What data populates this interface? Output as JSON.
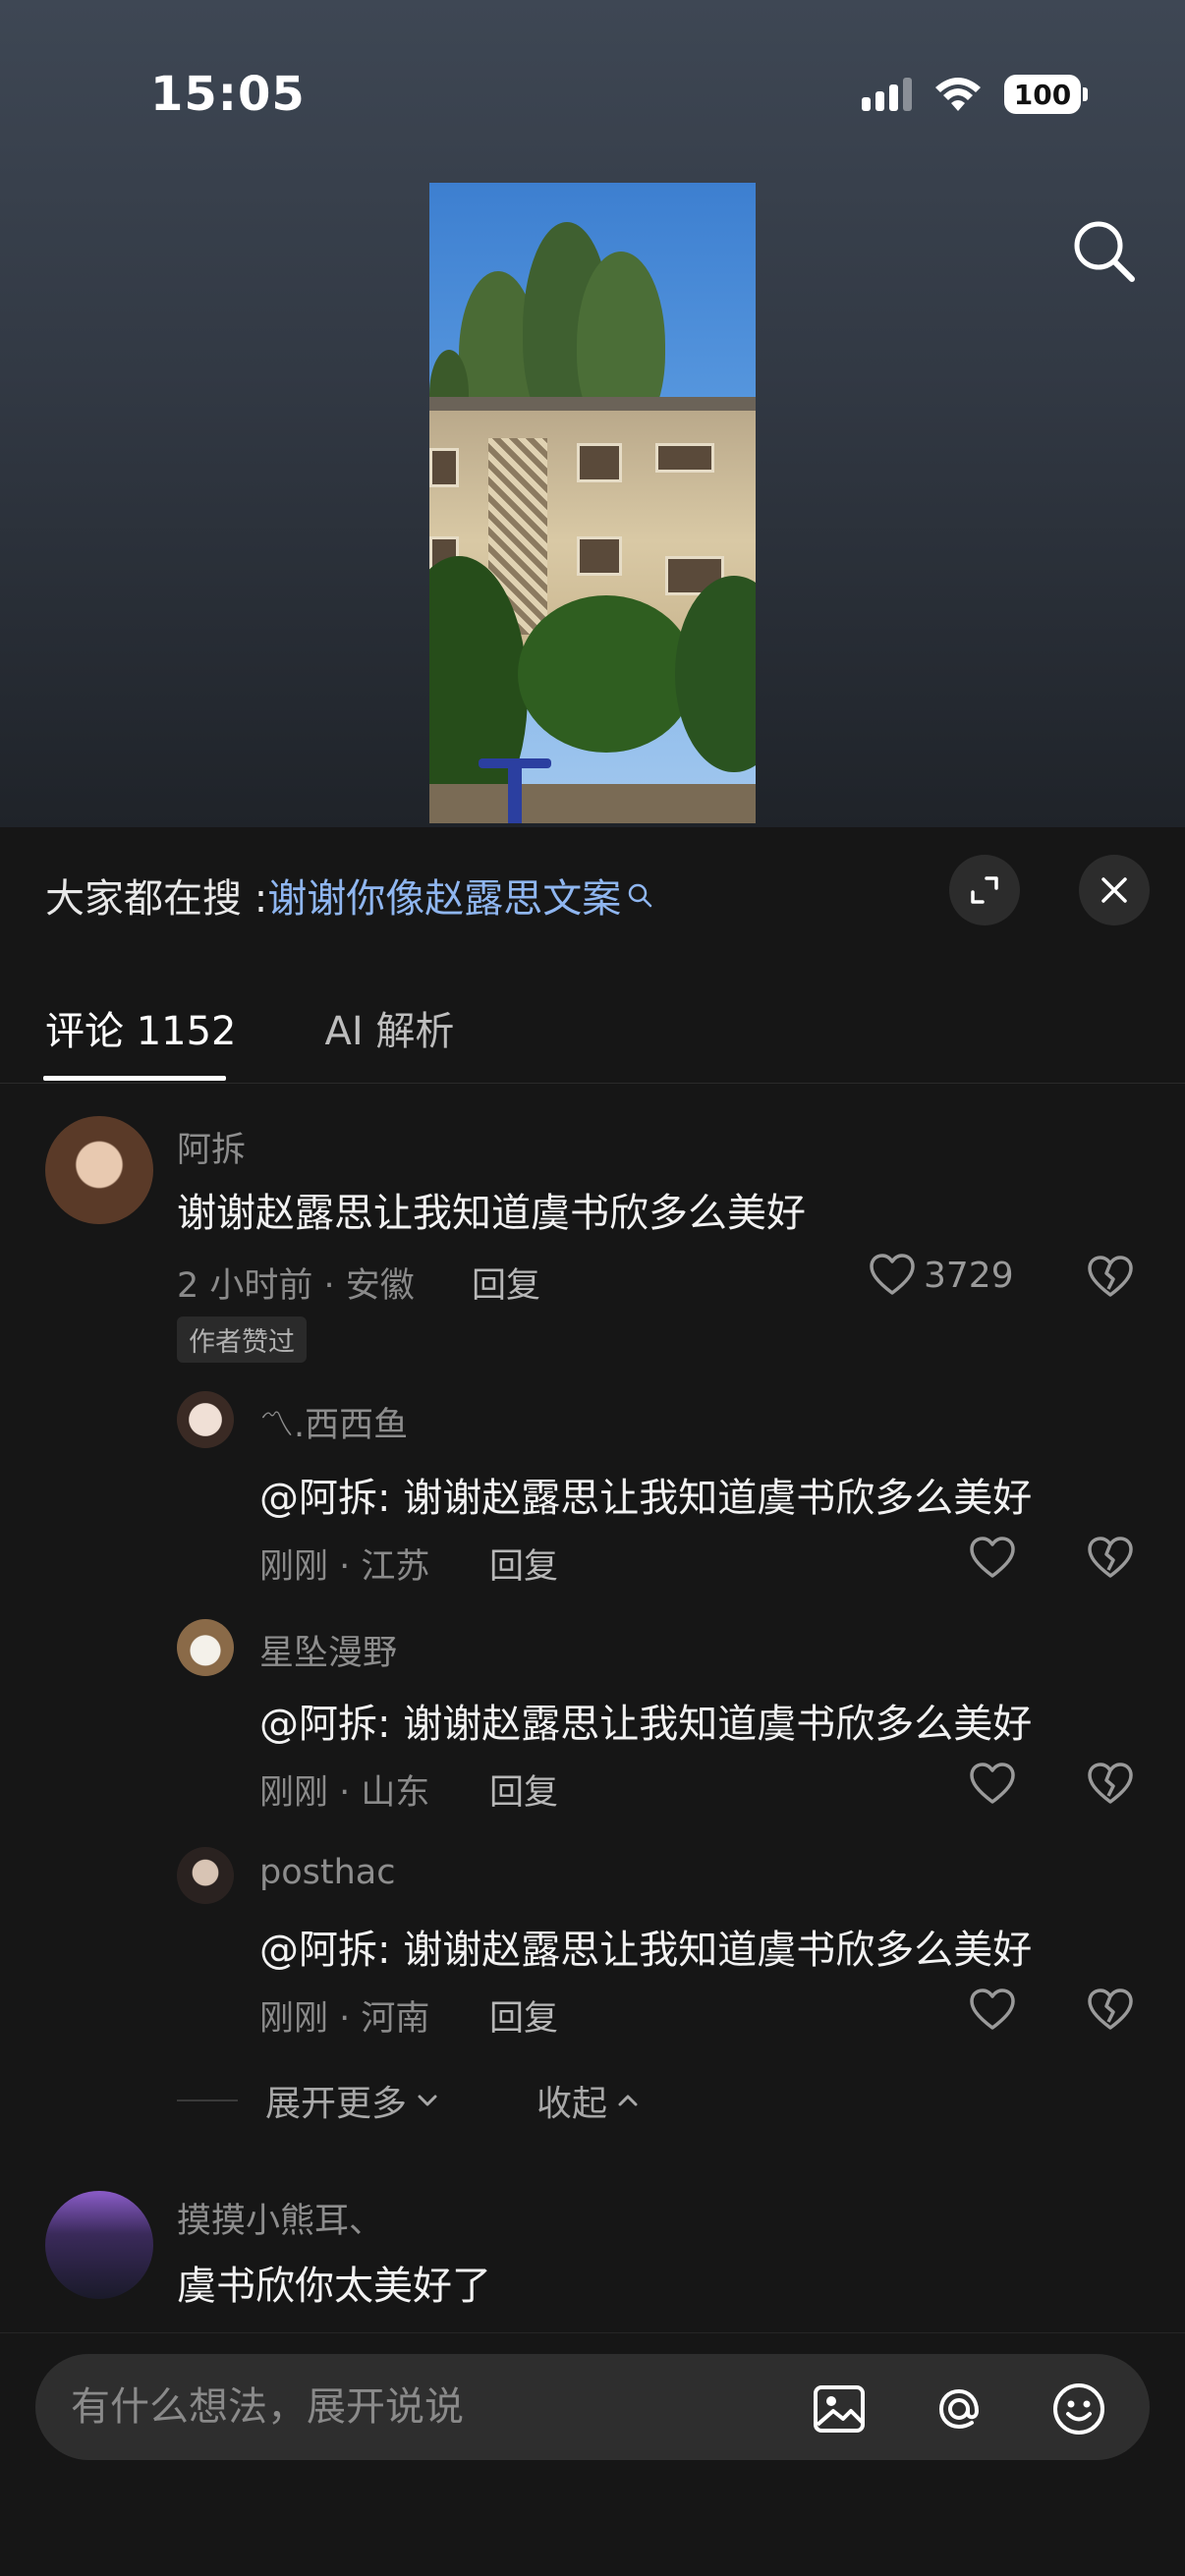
{
  "status": {
    "time": "15:05",
    "battery": "100"
  },
  "trend": {
    "prefix": "大家都在搜 : ",
    "keyword": "谢谢你像赵露思文案"
  },
  "tabs": [
    {
      "label": "评论 1152"
    },
    {
      "label": "AI 解析"
    }
  ],
  "comments": [
    {
      "name": "阿拆",
      "text": "谢谢赵露思让我知道虞书欣多么美好",
      "meta": "2 小时前 · 安徽",
      "reply": "回复",
      "likes": "3729",
      "badge": "作者赞过",
      "replies": [
        {
          "name": "〽.西西鱼",
          "text": "@阿拆: 谢谢赵露思让我知道虞书欣多么美好",
          "meta": "刚刚 · 江苏",
          "reply": "回复"
        },
        {
          "name": "星坠漫野",
          "text": "@阿拆: 谢谢赵露思让我知道虞书欣多么美好",
          "meta": "刚刚 · 山东",
          "reply": "回复"
        },
        {
          "name": "posthac",
          "text": "@阿拆: 谢谢赵露思让我知道虞书欣多么美好",
          "meta": "刚刚 · 河南",
          "reply": "回复"
        }
      ],
      "expand_more": "展开更多",
      "collapse": "收起"
    },
    {
      "name": "摸摸小熊耳、",
      "text": "虞书欣你太美好了"
    }
  ],
  "input": {
    "placeholder": "有什么想法，展开说说"
  },
  "icons": {
    "search": "search-icon",
    "expand": "expand-icon",
    "close": "close-icon",
    "heart": "heart-icon",
    "broken_heart": "broken-heart-icon",
    "image": "image-icon",
    "at": "at-icon",
    "emoji": "emoji-icon"
  },
  "colors": {
    "accent_link": "#8fb6f0",
    "background": "#161616"
  }
}
